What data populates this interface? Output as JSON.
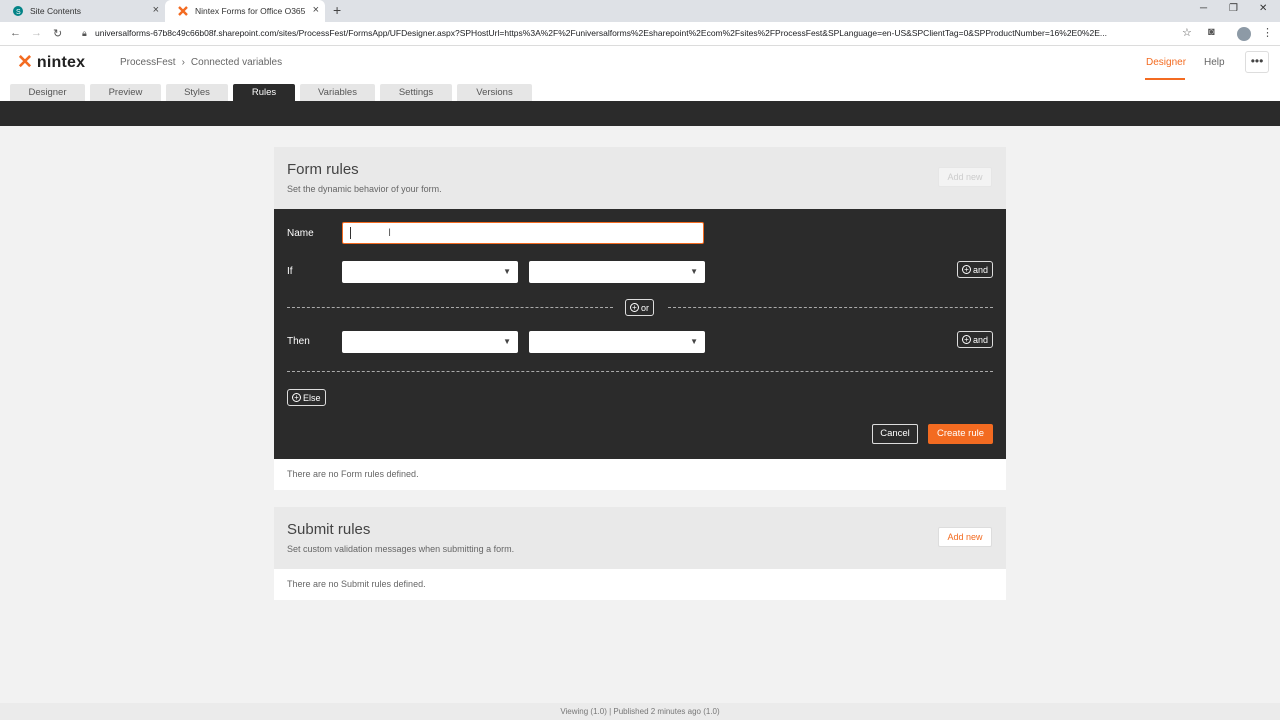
{
  "browser": {
    "tabs": [
      {
        "label": "Site Contents",
        "icon": "sharepoint-icon"
      },
      {
        "label": "Nintex Forms for Office O365",
        "icon": "nintex-icon"
      }
    ],
    "new_tab": "+",
    "url": "universalforms-67b8c49c66b08f.sharepoint.com/sites/ProcessFest/FormsApp/UFDesigner.aspx?SPHostUrl=https%3A%2F%2Funiversalforms%2Esharepoint%2Ecom%2Fsites%2FProcessFest&SPLanguage=en-US&SPClientTag=0&SPProductNumber=16%2E0%2E..."
  },
  "app": {
    "logo": "nintex",
    "breadcrumb": [
      "ProcessFest",
      "Connected variables"
    ],
    "breadcrumb_sep": "›",
    "header_links": {
      "designer": "Designer",
      "help": "Help"
    },
    "more": "•••",
    "tabs": [
      "Designer",
      "Preview",
      "Styles",
      "Rules",
      "Variables",
      "Settings",
      "Versions"
    ],
    "active_tab": "Rules",
    "accent": "#f36b21"
  },
  "form_rules": {
    "title": "Form rules",
    "subtitle": "Set the dynamic behavior of your form.",
    "add_new": "Add new",
    "editor": {
      "name_label": "Name",
      "name_value": "",
      "if_label": "If",
      "then_label": "Then",
      "and_label": "and",
      "or_label": "or",
      "else_label": "Else",
      "cancel": "Cancel",
      "create": "Create rule"
    },
    "empty": "There are no Form rules defined."
  },
  "submit_rules": {
    "title": "Submit rules",
    "subtitle": "Set custom validation messages when submitting a form.",
    "add_new": "Add new",
    "empty": "There are no Submit rules defined."
  },
  "status": "Viewing (1.0)  |  Published 2 minutes ago (1.0)"
}
